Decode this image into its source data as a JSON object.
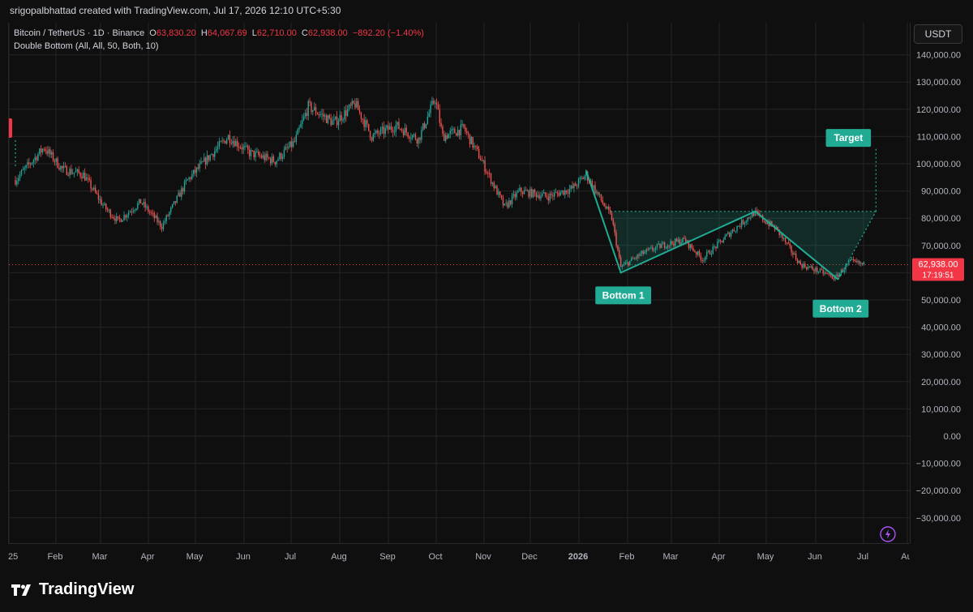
{
  "header": {
    "credit": "srigopalbhattad created with TradingView.com, Jul 17, 2026 12:10 UTC+5:30"
  },
  "legend": {
    "symbol": "Bitcoin / TetherUS · 1D · Binance",
    "o_label": "O",
    "o_val": "63,830.20",
    "h_label": "H",
    "h_val": "64,067.69",
    "l_label": "L",
    "l_val": "62,710.00",
    "c_label": "C",
    "c_val": "62,938.00",
    "change": "−892.20 (−1.40%)",
    "indicator": "Double Bottom (All, All, 50, Both, 10)"
  },
  "price_axis": {
    "unit": "USDT",
    "last_price": "62,938.00",
    "countdown": "17:19:51"
  },
  "brand": {
    "name": "TradingView"
  },
  "colors": {
    "up": "#26a69a",
    "down": "#ef5350",
    "pattern": "#22ab94",
    "last_price_bg": "#f23645"
  },
  "chart_data": {
    "type": "candlestick",
    "y_ticks": [
      "140,000.00",
      "130,000.00",
      "120,000.00",
      "110,000.00",
      "100,000.00",
      "90,000.00",
      "80,000.00",
      "70,000.00",
      "60,000.00",
      "50,000.00",
      "40,000.00",
      "30,000.00",
      "20,000.00",
      "10,000.00",
      "0.00",
      "−10,000.00",
      "−20,000.00",
      "−30,000.00"
    ],
    "ylim": [
      -35000,
      147000
    ],
    "x_ticks": [
      "25",
      "Feb",
      "Mar",
      "Apr",
      "May",
      "Jun",
      "Jul",
      "Aug",
      "Sep",
      "Oct",
      "Nov",
      "Dec",
      "2026",
      "Feb",
      "Mar",
      "Apr",
      "May",
      "Jun",
      "Jul",
      "Au"
    ],
    "price_path": [
      [
        "2025-01-01",
        94000
      ],
      [
        "2025-01-20",
        106000
      ],
      [
        "2025-02-01",
        98000
      ],
      [
        "2025-02-15",
        96000
      ],
      [
        "2025-03-01",
        84000
      ],
      [
        "2025-03-10",
        79000
      ],
      [
        "2025-03-25",
        86000
      ],
      [
        "2025-04-08",
        77000
      ],
      [
        "2025-04-25",
        94000
      ],
      [
        "2025-05-10",
        103000
      ],
      [
        "2025-05-22",
        110000
      ],
      [
        "2025-06-05",
        104000
      ],
      [
        "2025-06-22",
        101000
      ],
      [
        "2025-07-05",
        108000
      ],
      [
        "2025-07-14",
        121000
      ],
      [
        "2025-07-31",
        115000
      ],
      [
        "2025-08-14",
        122000
      ],
      [
        "2025-08-25",
        110000
      ],
      [
        "2025-09-10",
        114000
      ],
      [
        "2025-09-25",
        109000
      ],
      [
        "2025-10-06",
        124000
      ],
      [
        "2025-10-11",
        110000
      ],
      [
        "2025-10-25",
        113000
      ],
      [
        "2025-11-05",
        102000
      ],
      [
        "2025-11-21",
        84000
      ],
      [
        "2025-12-01",
        90000
      ],
      [
        "2025-12-20",
        88000
      ],
      [
        "2026-01-05",
        91000
      ],
      [
        "2026-01-14",
        96000
      ],
      [
        "2026-01-31",
        80000
      ],
      [
        "2026-02-06",
        62000
      ],
      [
        "2026-02-20",
        67000
      ],
      [
        "2026-03-05",
        70000
      ],
      [
        "2026-03-20",
        72000
      ],
      [
        "2026-04-01",
        65000
      ],
      [
        "2026-04-20",
        75000
      ],
      [
        "2026-05-05",
        82000
      ],
      [
        "2026-05-20",
        76000
      ],
      [
        "2026-06-05",
        63000
      ],
      [
        "2026-06-20",
        60000
      ],
      [
        "2026-06-28",
        58000
      ],
      [
        "2026-07-08",
        64000
      ],
      [
        "2026-07-17",
        62938
      ]
    ],
    "pattern": {
      "name": "Double Bottom",
      "points": [
        {
          "label": "",
          "date": "2026-01-14",
          "price": 97500
        },
        {
          "label": "Bottom 1",
          "date": "2026-02-06",
          "price": 60000
        },
        {
          "label": "",
          "date": "2026-05-06",
          "price": 82500
        },
        {
          "label": "Bottom 2",
          "date": "2026-06-30",
          "price": 57500
        }
      ],
      "neckline": 82500,
      "target_label": "Target",
      "target": 108000
    },
    "last_price": 62938
  }
}
